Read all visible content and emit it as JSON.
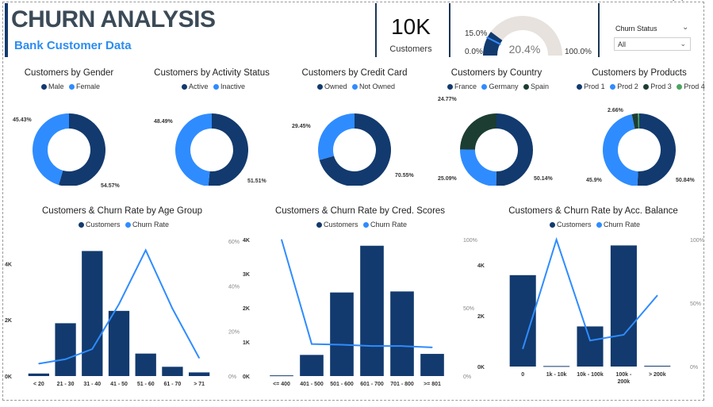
{
  "header": {
    "title": "CHURN ANALYSIS",
    "subtitle": "Bank Customer Data",
    "kpi_value": "10K",
    "kpi_label": "Customers"
  },
  "gauge": {
    "min_label": "0.0%",
    "max_label": "100.0%",
    "target_label": "15.0%",
    "value_label": "20.4%",
    "value": 0.204,
    "target": 0.15,
    "fill_color": "#123a6e",
    "track_color": "#e7e2dd"
  },
  "slicer": {
    "title": "Churn Status",
    "selected": "All"
  },
  "colors": {
    "dark": "#123a6e",
    "light": "#2f8cff",
    "country_spain": "#1c3d32",
    "prod4": "#4aa560"
  },
  "chart_data": [
    {
      "type": "pie",
      "title": "Customers by Gender",
      "labels": [
        "Male",
        "Female"
      ],
      "values": [
        54.57,
        45.43
      ],
      "label_text": [
        "54.57%",
        "45.43%"
      ],
      "legend": [
        "Male",
        "Female"
      ]
    },
    {
      "type": "pie",
      "title": "Customers by Activity Status",
      "labels": [
        "Active",
        "Inactive"
      ],
      "values": [
        51.51,
        48.49
      ],
      "label_text": [
        "51.51%",
        "48.49%"
      ],
      "legend": [
        "Active",
        "Inactive"
      ]
    },
    {
      "type": "pie",
      "title": "Customers by Credit Card",
      "labels": [
        "Owned",
        "Not Owned"
      ],
      "values": [
        70.55,
        29.45
      ],
      "label_text": [
        "70.55%",
        "29.45%"
      ],
      "legend": [
        "Owned",
        "Not Owned"
      ]
    },
    {
      "type": "pie",
      "title": "Customers by Country",
      "labels": [
        "France",
        "Germany",
        "Spain"
      ],
      "values": [
        50.14,
        25.09,
        24.77
      ],
      "label_text": [
        "50.14%",
        "25.09%",
        "24.77%"
      ],
      "legend": [
        "France",
        "Germany",
        "Spain"
      ]
    },
    {
      "type": "pie",
      "title": "Customers by Products",
      "labels": [
        "Prod 1",
        "Prod 2",
        "Prod 3",
        "Prod 4"
      ],
      "values": [
        50.84,
        45.9,
        2.66,
        0.6
      ],
      "label_text": [
        "50.84%",
        "45.9%",
        "2.66%",
        ""
      ],
      "legend": [
        "Prod 1",
        "Prod 2",
        "Prod 3",
        "Prod 4"
      ]
    },
    {
      "type": "bar",
      "title": "Customers & Churn Rate by Age Group",
      "legend": [
        "Customers",
        "Churn Rate"
      ],
      "categories": [
        "< 20",
        "21 - 30",
        "31 - 40",
        "41 - 50",
        "51 - 60",
        "61 - 70",
        "> 71"
      ],
      "customers": [
        90,
        1880,
        4450,
        2320,
        800,
        330,
        130
      ],
      "churn_rate": [
        5.5,
        7.5,
        12,
        32,
        56,
        30,
        8
      ],
      "y_ticks": [
        "0K",
        "2K",
        "4K"
      ],
      "y_tick_values": [
        0,
        2000,
        4000
      ],
      "ylim": [
        0,
        4800
      ],
      "y2_ticks": [
        "0%",
        "20%",
        "40%",
        "60%"
      ],
      "y2_tick_values": [
        0,
        20,
        40,
        60
      ],
      "y2lim": [
        0,
        60
      ]
    },
    {
      "type": "bar",
      "title": "Customers & Churn Rate by Cred. Scores",
      "legend": [
        "Customers",
        "Churn Rate"
      ],
      "categories": [
        "<= 400",
        "401 - 500",
        "501 - 600",
        "601 - 700",
        "701 - 800",
        ">= 801"
      ],
      "customers": [
        20,
        620,
        2450,
        3820,
        2480,
        650
      ],
      "churn_rate": [
        100,
        23.5,
        23,
        22,
        22,
        21
      ],
      "y_ticks": [
        "0K",
        "1K",
        "2K",
        "3K",
        "4K"
      ],
      "y_tick_values": [
        0,
        1000,
        2000,
        3000,
        4000
      ],
      "ylim": [
        0,
        4000
      ],
      "y2_ticks": [
        "0%",
        "50%",
        "100%"
      ],
      "y2_tick_values": [
        0,
        50,
        100
      ],
      "y2lim": [
        0,
        100
      ]
    },
    {
      "type": "bar",
      "title": "Customers & Churn Rate by Acc. Balance",
      "legend": [
        "Customers",
        "Churn Rate"
      ],
      "categories": [
        "0",
        "1k - 10k",
        "10k - 100k",
        "100k - 200k",
        "> 200k"
      ],
      "customers": [
        3600,
        20,
        1580,
        4770,
        30
      ],
      "churn_rate": [
        14,
        100,
        20.5,
        25,
        56
      ],
      "y_ticks": [
        "0K",
        "2K",
        "4K"
      ],
      "y_tick_values": [
        0,
        2000,
        4000
      ],
      "ylim": [
        0,
        5000
      ],
      "y2_ticks": [
        "0%",
        "50%",
        "100%"
      ],
      "y2_tick_values": [
        0,
        50,
        100
      ],
      "y2lim": [
        0,
        100
      ]
    }
  ]
}
